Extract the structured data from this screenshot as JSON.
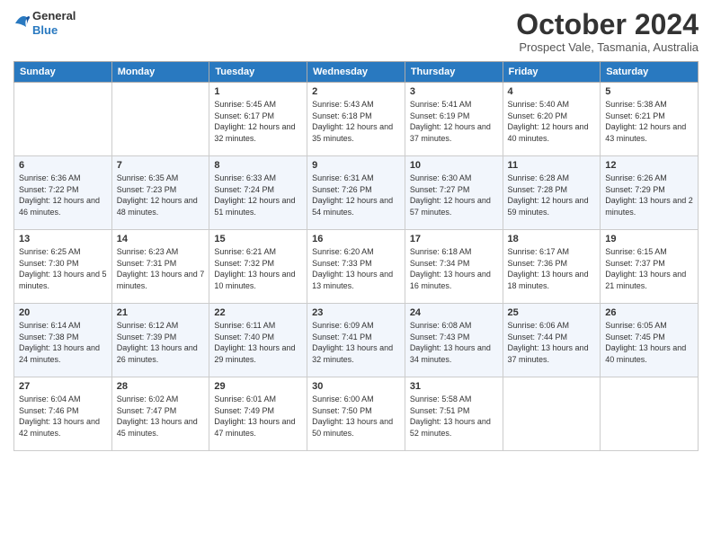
{
  "logo": {
    "line1": "General",
    "line2": "Blue"
  },
  "title": "October 2024",
  "subtitle": "Prospect Vale, Tasmania, Australia",
  "days_of_week": [
    "Sunday",
    "Monday",
    "Tuesday",
    "Wednesday",
    "Thursday",
    "Friday",
    "Saturday"
  ],
  "weeks": [
    [
      {
        "day": "",
        "info": ""
      },
      {
        "day": "",
        "info": ""
      },
      {
        "day": "1",
        "sunrise": "5:45 AM",
        "sunset": "6:17 PM",
        "daylight": "12 hours and 32 minutes."
      },
      {
        "day": "2",
        "sunrise": "5:43 AM",
        "sunset": "6:18 PM",
        "daylight": "12 hours and 35 minutes."
      },
      {
        "day": "3",
        "sunrise": "5:41 AM",
        "sunset": "6:19 PM",
        "daylight": "12 hours and 37 minutes."
      },
      {
        "day": "4",
        "sunrise": "5:40 AM",
        "sunset": "6:20 PM",
        "daylight": "12 hours and 40 minutes."
      },
      {
        "day": "5",
        "sunrise": "5:38 AM",
        "sunset": "6:21 PM",
        "daylight": "12 hours and 43 minutes."
      }
    ],
    [
      {
        "day": "6",
        "sunrise": "6:36 AM",
        "sunset": "7:22 PM",
        "daylight": "12 hours and 46 minutes."
      },
      {
        "day": "7",
        "sunrise": "6:35 AM",
        "sunset": "7:23 PM",
        "daylight": "12 hours and 48 minutes."
      },
      {
        "day": "8",
        "sunrise": "6:33 AM",
        "sunset": "7:24 PM",
        "daylight": "12 hours and 51 minutes."
      },
      {
        "day": "9",
        "sunrise": "6:31 AM",
        "sunset": "7:26 PM",
        "daylight": "12 hours and 54 minutes."
      },
      {
        "day": "10",
        "sunrise": "6:30 AM",
        "sunset": "7:27 PM",
        "daylight": "12 hours and 57 minutes."
      },
      {
        "day": "11",
        "sunrise": "6:28 AM",
        "sunset": "7:28 PM",
        "daylight": "12 hours and 59 minutes."
      },
      {
        "day": "12",
        "sunrise": "6:26 AM",
        "sunset": "7:29 PM",
        "daylight": "13 hours and 2 minutes."
      }
    ],
    [
      {
        "day": "13",
        "sunrise": "6:25 AM",
        "sunset": "7:30 PM",
        "daylight": "13 hours and 5 minutes."
      },
      {
        "day": "14",
        "sunrise": "6:23 AM",
        "sunset": "7:31 PM",
        "daylight": "13 hours and 7 minutes."
      },
      {
        "day": "15",
        "sunrise": "6:21 AM",
        "sunset": "7:32 PM",
        "daylight": "13 hours and 10 minutes."
      },
      {
        "day": "16",
        "sunrise": "6:20 AM",
        "sunset": "7:33 PM",
        "daylight": "13 hours and 13 minutes."
      },
      {
        "day": "17",
        "sunrise": "6:18 AM",
        "sunset": "7:34 PM",
        "daylight": "13 hours and 16 minutes."
      },
      {
        "day": "18",
        "sunrise": "6:17 AM",
        "sunset": "7:36 PM",
        "daylight": "13 hours and 18 minutes."
      },
      {
        "day": "19",
        "sunrise": "6:15 AM",
        "sunset": "7:37 PM",
        "daylight": "13 hours and 21 minutes."
      }
    ],
    [
      {
        "day": "20",
        "sunrise": "6:14 AM",
        "sunset": "7:38 PM",
        "daylight": "13 hours and 24 minutes."
      },
      {
        "day": "21",
        "sunrise": "6:12 AM",
        "sunset": "7:39 PM",
        "daylight": "13 hours and 26 minutes."
      },
      {
        "day": "22",
        "sunrise": "6:11 AM",
        "sunset": "7:40 PM",
        "daylight": "13 hours and 29 minutes."
      },
      {
        "day": "23",
        "sunrise": "6:09 AM",
        "sunset": "7:41 PM",
        "daylight": "13 hours and 32 minutes."
      },
      {
        "day": "24",
        "sunrise": "6:08 AM",
        "sunset": "7:43 PM",
        "daylight": "13 hours and 34 minutes."
      },
      {
        "day": "25",
        "sunrise": "6:06 AM",
        "sunset": "7:44 PM",
        "daylight": "13 hours and 37 minutes."
      },
      {
        "day": "26",
        "sunrise": "6:05 AM",
        "sunset": "7:45 PM",
        "daylight": "13 hours and 40 minutes."
      }
    ],
    [
      {
        "day": "27",
        "sunrise": "6:04 AM",
        "sunset": "7:46 PM",
        "daylight": "13 hours and 42 minutes."
      },
      {
        "day": "28",
        "sunrise": "6:02 AM",
        "sunset": "7:47 PM",
        "daylight": "13 hours and 45 minutes."
      },
      {
        "day": "29",
        "sunrise": "6:01 AM",
        "sunset": "7:49 PM",
        "daylight": "13 hours and 47 minutes."
      },
      {
        "day": "30",
        "sunrise": "6:00 AM",
        "sunset": "7:50 PM",
        "daylight": "13 hours and 50 minutes."
      },
      {
        "day": "31",
        "sunrise": "5:58 AM",
        "sunset": "7:51 PM",
        "daylight": "13 hours and 52 minutes."
      },
      {
        "day": "",
        "info": ""
      },
      {
        "day": "",
        "info": ""
      }
    ]
  ],
  "labels": {
    "sunrise": "Sunrise:",
    "sunset": "Sunset:",
    "daylight": "Daylight:"
  }
}
